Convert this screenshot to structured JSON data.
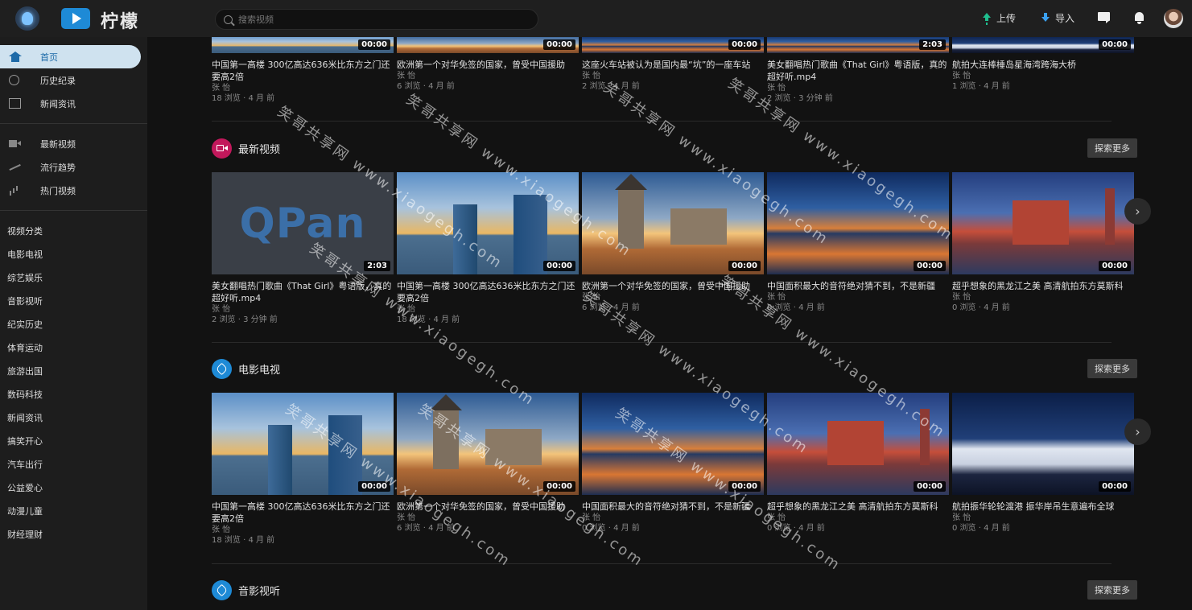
{
  "header": {
    "brand": "柠檬",
    "search_placeholder": "搜索视频",
    "upload_label": "上传",
    "import_label": "导入"
  },
  "sidebar": {
    "nav": [
      {
        "label": "首页",
        "icon": "home-icon",
        "active": true
      },
      {
        "label": "历史纪录",
        "icon": "history-icon"
      },
      {
        "label": "新闻资讯",
        "icon": "news-icon"
      }
    ],
    "nav2": [
      {
        "label": "最新视频",
        "icon": "video-icon"
      },
      {
        "label": "流行趋势",
        "icon": "trend-icon"
      },
      {
        "label": "热门视频",
        "icon": "hot-icon"
      }
    ],
    "categories_title": "视频分类",
    "categories": [
      "电影电视",
      "综艺娱乐",
      "音影视听",
      "纪实历史",
      "体育运动",
      "旅游出国",
      "数码科技",
      "新闻资讯",
      "搞笑开心",
      "汽车出行",
      "公益爱心",
      "动漫儿童",
      "财经理财"
    ]
  },
  "top_row": [
    {
      "title": "中国第一高楼 300亿高达636米比东方之门还要高2倍",
      "author": "张 怡",
      "meta": "18 浏览 · 4 月 前",
      "duration": "00:00"
    },
    {
      "title": "欧洲第一个对华免签的国家，曾受中国援助",
      "author": "张 怡",
      "meta": "6 浏览 · 4 月 前",
      "duration": "00:00"
    },
    {
      "title": "这座火车站被认为是国内最“坑”的一座车站",
      "author": "张 怡",
      "meta": "2 浏览 · 4 月 前",
      "duration": "00:00"
    },
    {
      "title": "美女翻唱热门歌曲《That Girl》粤语版，真的超好听.mp4",
      "author": "张 怡",
      "meta": "2 浏览 · 3 分钟 前",
      "duration": "2:03"
    },
    {
      "title": "航拍大连棒棰岛星海湾跨海大桥",
      "author": "张 怡",
      "meta": "1 浏览 · 4 月 前",
      "duration": "00:00"
    }
  ],
  "sections": [
    {
      "title": "最新视频",
      "icon": "camera-icon",
      "color": "#c2185b",
      "more_label": "探索更多",
      "videos": [
        {
          "title": "美女翻唱热门歌曲《That Girl》粤语版，真的超好听.mp4",
          "author": "张 怡",
          "meta": "2 浏览 · 3 分钟 前",
          "duration": "2:03",
          "thumb": "qpan",
          "thumb_text": "QPan"
        },
        {
          "title": "中国第一高楼 300亿高达636米比东方之门还要高2倍",
          "author": "张 怡",
          "meta": "18 浏览 · 4 月 前",
          "duration": "00:00",
          "thumb": "city"
        },
        {
          "title": "欧洲第一个对华免签的国家，曾受中国援助",
          "author": "张 怡",
          "meta": "6 浏览 · 4 月 前",
          "duration": "00:00",
          "thumb": "castle"
        },
        {
          "title": "中国面积最大的音符绝对猜不到，不是新疆",
          "author": "张 怡",
          "meta": "0 浏览 · 4 月 前",
          "duration": "00:00",
          "thumb": "lake"
        },
        {
          "title": "超乎想象的黑龙江之美 高清航拍东方莫斯科",
          "author": "张 怡",
          "meta": "0 浏览 · 4 月 前",
          "duration": "00:00",
          "thumb": "kremlin"
        }
      ]
    },
    {
      "title": "电影电视",
      "icon": "tag-icon",
      "color": "#1e8ad6",
      "more_label": "探索更多",
      "videos": [
        {
          "title": "中国第一高楼 300亿高达636米比东方之门还要高2倍",
          "author": "张 怡",
          "meta": "18 浏览 · 4 月 前",
          "duration": "00:00",
          "thumb": "city"
        },
        {
          "title": "欧洲第一个对华免签的国家，曾受中国援助",
          "author": "张 怡",
          "meta": "6 浏览 · 4 月 前",
          "duration": "00:00",
          "thumb": "castle"
        },
        {
          "title": "中国面积最大的音符绝对猜不到，不是新疆",
          "author": "张 怡",
          "meta": "0 浏览 · 4 月 前",
          "duration": "00:00",
          "thumb": "lake"
        },
        {
          "title": "超乎想象的黑龙江之美 高清航拍东方莫斯科",
          "author": "张 怡",
          "meta": "0 浏览 · 4 月 前",
          "duration": "00:00",
          "thumb": "kremlin"
        },
        {
          "title": "航拍振华轮轮渡港 振华岸吊生意遍布全球",
          "author": "张 怡",
          "meta": "0 浏览 · 4 月 前",
          "duration": "00:00",
          "thumb": "ship"
        }
      ]
    },
    {
      "title": "音影视听",
      "icon": "tag-icon",
      "color": "#1e8ad6",
      "more_label": "探索更多"
    }
  ],
  "watermark": "笑哥共享网 www.xiaogegh.com"
}
